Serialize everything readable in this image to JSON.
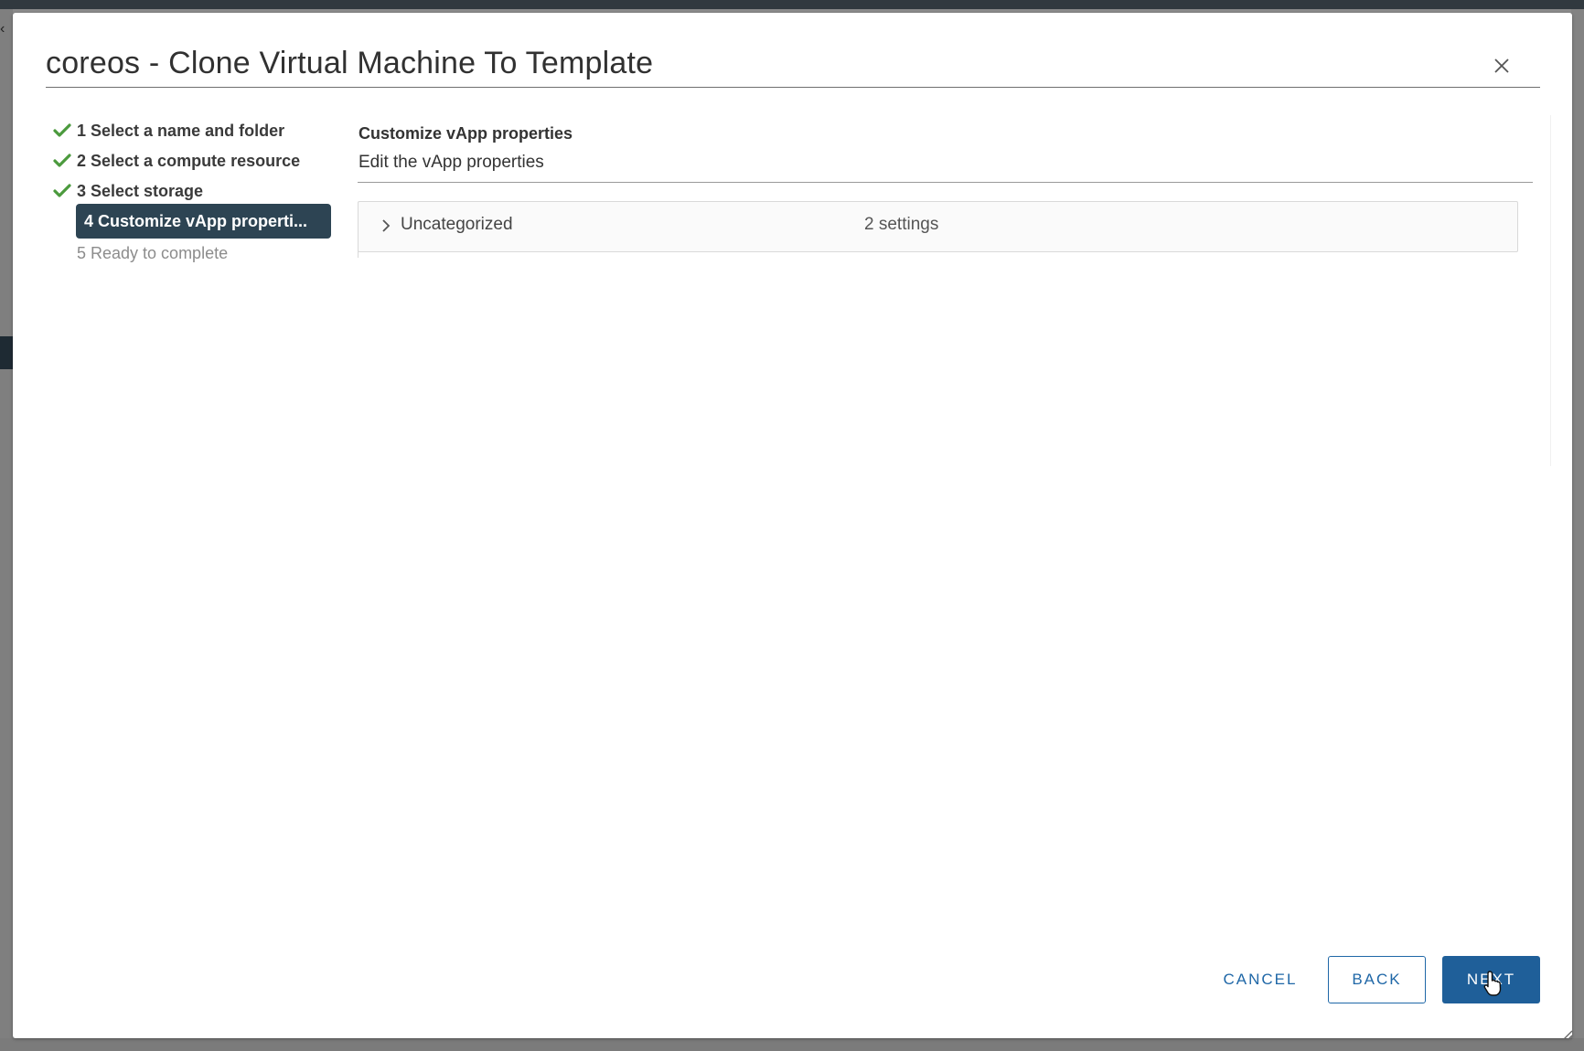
{
  "dialog": {
    "title": "coreos - Clone Virtual Machine To Template",
    "close_icon": "close-icon"
  },
  "steps": [
    {
      "label": "1 Select a name and folder",
      "state": "done"
    },
    {
      "label": "2 Select a compute resource",
      "state": "done"
    },
    {
      "label": "3 Select storage",
      "state": "done"
    },
    {
      "label": "4 Customize vApp properti...",
      "state": "active"
    },
    {
      "label": "5 Ready to complete",
      "state": "pending"
    }
  ],
  "content": {
    "heading": "Customize vApp properties",
    "subheading": "Edit the vApp properties",
    "groups": [
      {
        "name": "Uncategorized",
        "count": "2 settings",
        "expanded": false
      }
    ]
  },
  "footer": {
    "cancel_label": "CANCEL",
    "back_label": "BACK",
    "next_label": "NEXT"
  },
  "colors": {
    "primary": "#1f5f99",
    "active_step": "#2d4453",
    "check": "#4b9a3d"
  }
}
